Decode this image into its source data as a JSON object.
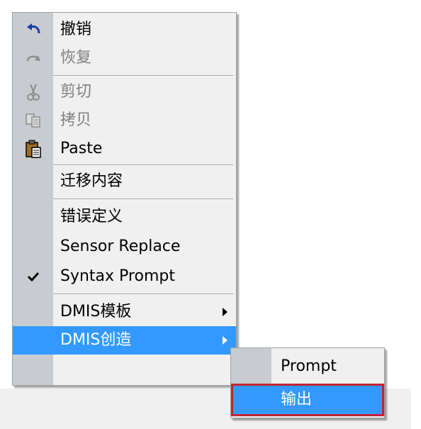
{
  "menu": {
    "items": [
      {
        "label": "撤销",
        "icon": "undo-icon",
        "enabled": true
      },
      {
        "label": "恢复",
        "icon": "redo-icon",
        "enabled": false
      },
      {
        "label": "剪切",
        "icon": "cut-icon",
        "enabled": false
      },
      {
        "label": "拷贝",
        "icon": "copy-icon",
        "enabled": false
      },
      {
        "label": "Paste",
        "icon": "paste-icon",
        "enabled": true
      },
      {
        "label": "迁移内容",
        "enabled": true
      },
      {
        "label": "错误定义",
        "enabled": true
      },
      {
        "label": "Sensor Replace",
        "enabled": true
      },
      {
        "label": "Syntax Prompt",
        "icon": "check-icon",
        "checked": true,
        "enabled": true
      },
      {
        "label": "DMIS模板",
        "submenu": true,
        "enabled": true
      },
      {
        "label": "DMIS创造",
        "submenu": true,
        "highlighted": true,
        "enabled": true
      }
    ]
  },
  "submenu": {
    "items": [
      {
        "label": "Prompt"
      },
      {
        "label": "输出",
        "highlighted": true,
        "annotated": true
      }
    ]
  },
  "colors": {
    "menu_bg": "#f0f0f0",
    "gutter": "#c8ccd0",
    "highlight": "#3399ff",
    "annotation": "#c0262e",
    "disabled_text": "#808080"
  }
}
